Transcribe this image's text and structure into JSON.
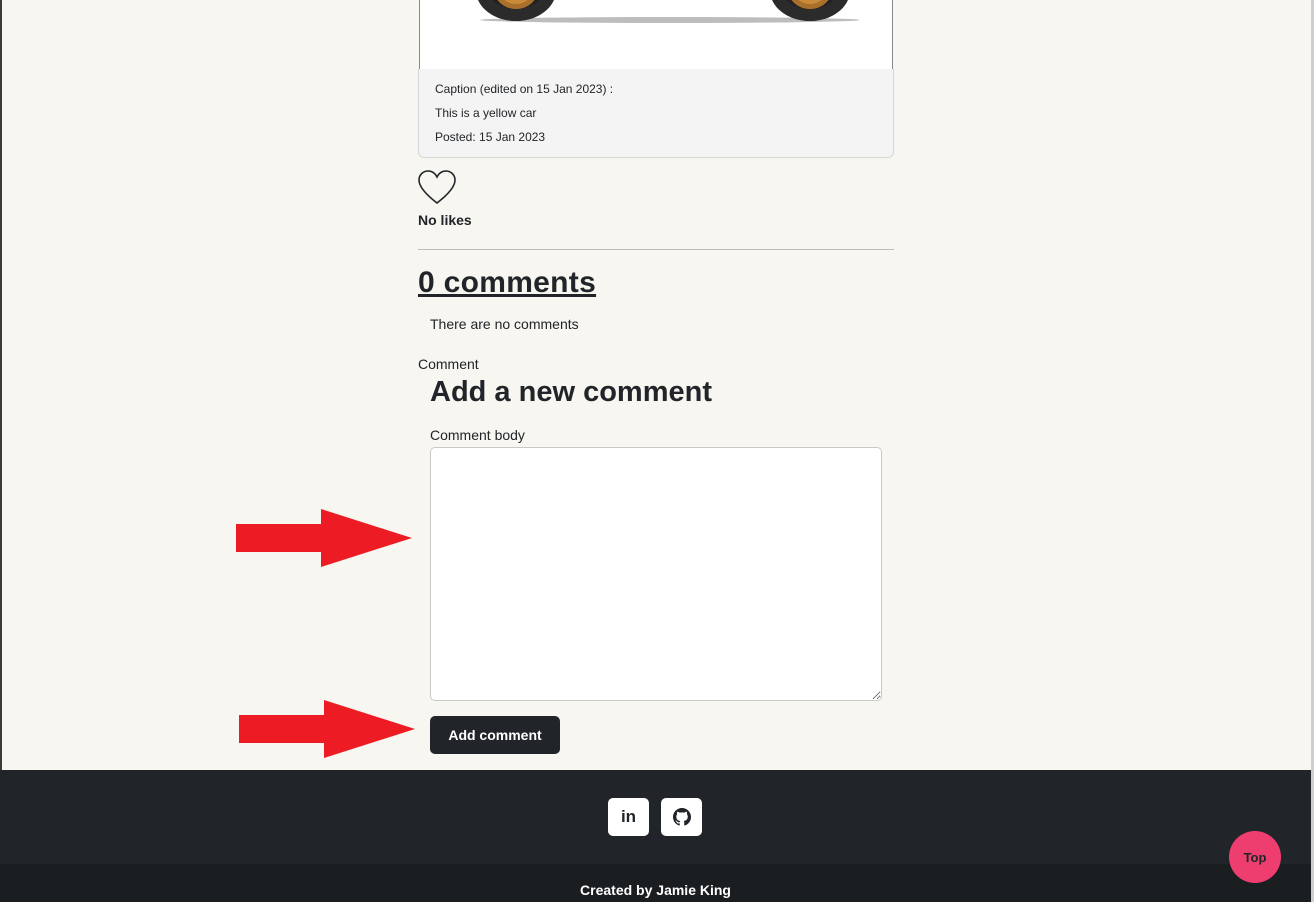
{
  "post": {
    "caption_label": "Caption (edited on 15 Jan 2023) :",
    "caption_text": "This is a yellow car",
    "posted": "Posted: 15 Jan 2023"
  },
  "likes": {
    "icon": "heart-outline-icon",
    "text": "No likes"
  },
  "comments": {
    "heading": "0 comments",
    "empty_text": "There are no comments"
  },
  "comment_form": {
    "section_label": "Comment",
    "heading": "Add a new comment",
    "body_label": "Comment body",
    "body_value": "",
    "submit_label": "Add comment"
  },
  "footer": {
    "social": [
      {
        "icon": "linkedin-icon",
        "label": "in"
      },
      {
        "icon": "github-icon"
      }
    ],
    "credit": "Created by Jamie King",
    "top_button": "Top"
  },
  "colors": {
    "page_bg": "#f7f6f1",
    "footer_bg": "#212529",
    "button_bg": "#212529",
    "top_button_bg": "#ee3d6f",
    "annotation_arrow": "#ed1c24"
  }
}
